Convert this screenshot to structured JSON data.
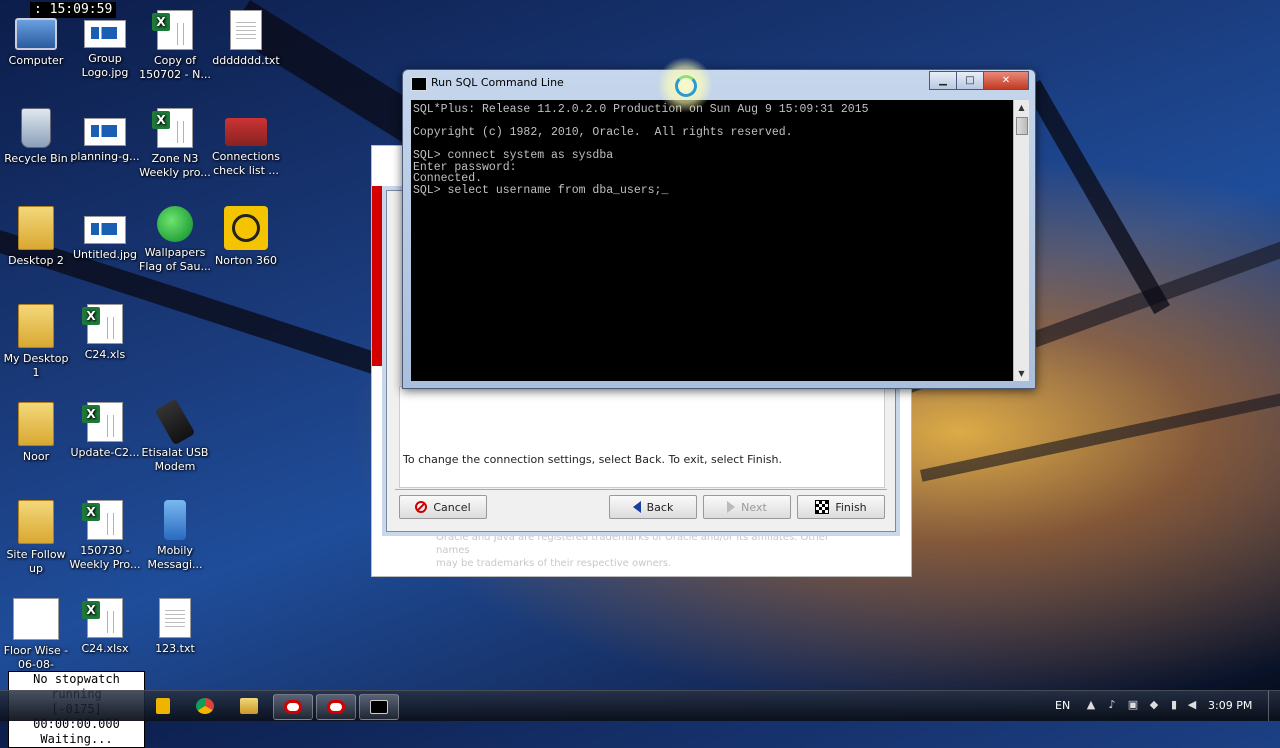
{
  "overlay": {
    "clock_time": ": 15:09:59"
  },
  "desktop_icons": [
    {
      "label": "Computer",
      "icon": "computer-icon"
    },
    {
      "label": "Group Logo.jpg",
      "icon": "image-icon"
    },
    {
      "label": "Copy of 150702 - N...",
      "icon": "excel-icon"
    },
    {
      "label": "ddddddd.txt",
      "icon": "text-file-icon"
    },
    {
      "label": "Recycle Bin",
      "icon": "recycle-bin-icon"
    },
    {
      "label": "planning-g...",
      "icon": "image-icon"
    },
    {
      "label": "Zone N3 Weekly pro...",
      "icon": "excel-icon"
    },
    {
      "label": "Connections check list ...",
      "icon": "image-icon"
    },
    {
      "label": "Desktop 2",
      "icon": "folder-icon"
    },
    {
      "label": "Untitled.jpg",
      "icon": "image-icon"
    },
    {
      "label": "Wallpapers Flag of Sau...",
      "icon": "globe-icon"
    },
    {
      "label": "Norton 360",
      "icon": "norton-icon"
    },
    {
      "label": "My Desktop 1",
      "icon": "folder-icon"
    },
    {
      "label": "C24.xls",
      "icon": "excel-icon"
    },
    {
      "label": "Noor",
      "icon": "folder-icon"
    },
    {
      "label": "Update-C2...",
      "icon": "excel-icon"
    },
    {
      "label": "Etisalat USB Modem",
      "icon": "usb-modem-icon"
    },
    {
      "label": "Site Follow up",
      "icon": "folder-icon"
    },
    {
      "label": "150730 - Weekly Pro...",
      "icon": "excel-icon"
    },
    {
      "label": "Mobily Messagi...",
      "icon": "phone-icon"
    },
    {
      "label": "Floor Wise - 06-08-2015...",
      "icon": "pdf-icon"
    },
    {
      "label": "C24.xlsx",
      "icon": "excel-icon"
    },
    {
      "label": "123.txt",
      "icon": "text-file-icon"
    }
  ],
  "installer": {
    "legal_line1": "Oracle and Java are registered trademarks of Oracle and/or its affiliates. Other names",
    "legal_line2": "may be trademarks of their respective owners.",
    "dialog_message": "To change the connection settings, select Back. To exit, select Finish.",
    "buttons": {
      "cancel": "Cancel",
      "back": "Back",
      "next": "Next",
      "finish": "Finish"
    }
  },
  "sql_window": {
    "title": "Run SQL Command Line",
    "lines": [
      "SQL*Plus: Release 11.2.0.2.0 Production on Sun Aug 9 15:09:31 2015",
      "",
      "Copyright (c) 1982, 2010, Oracle.  All rights reserved.",
      "",
      "SQL> connect system as sysdba",
      "Enter password:",
      "Connected.",
      "SQL> select username from dba_users;_"
    ]
  },
  "stopwatch": {
    "line1": "No stopwatch running",
    "line2": "[-0175]  00:00:00.000",
    "line3": "Waiting..."
  },
  "taskbar": {
    "language": "EN",
    "time": "3:09 PM"
  },
  "colors": {
    "accent_red": "#d40000",
    "console_bg": "#000000",
    "console_fg": "#c0c0c0"
  }
}
